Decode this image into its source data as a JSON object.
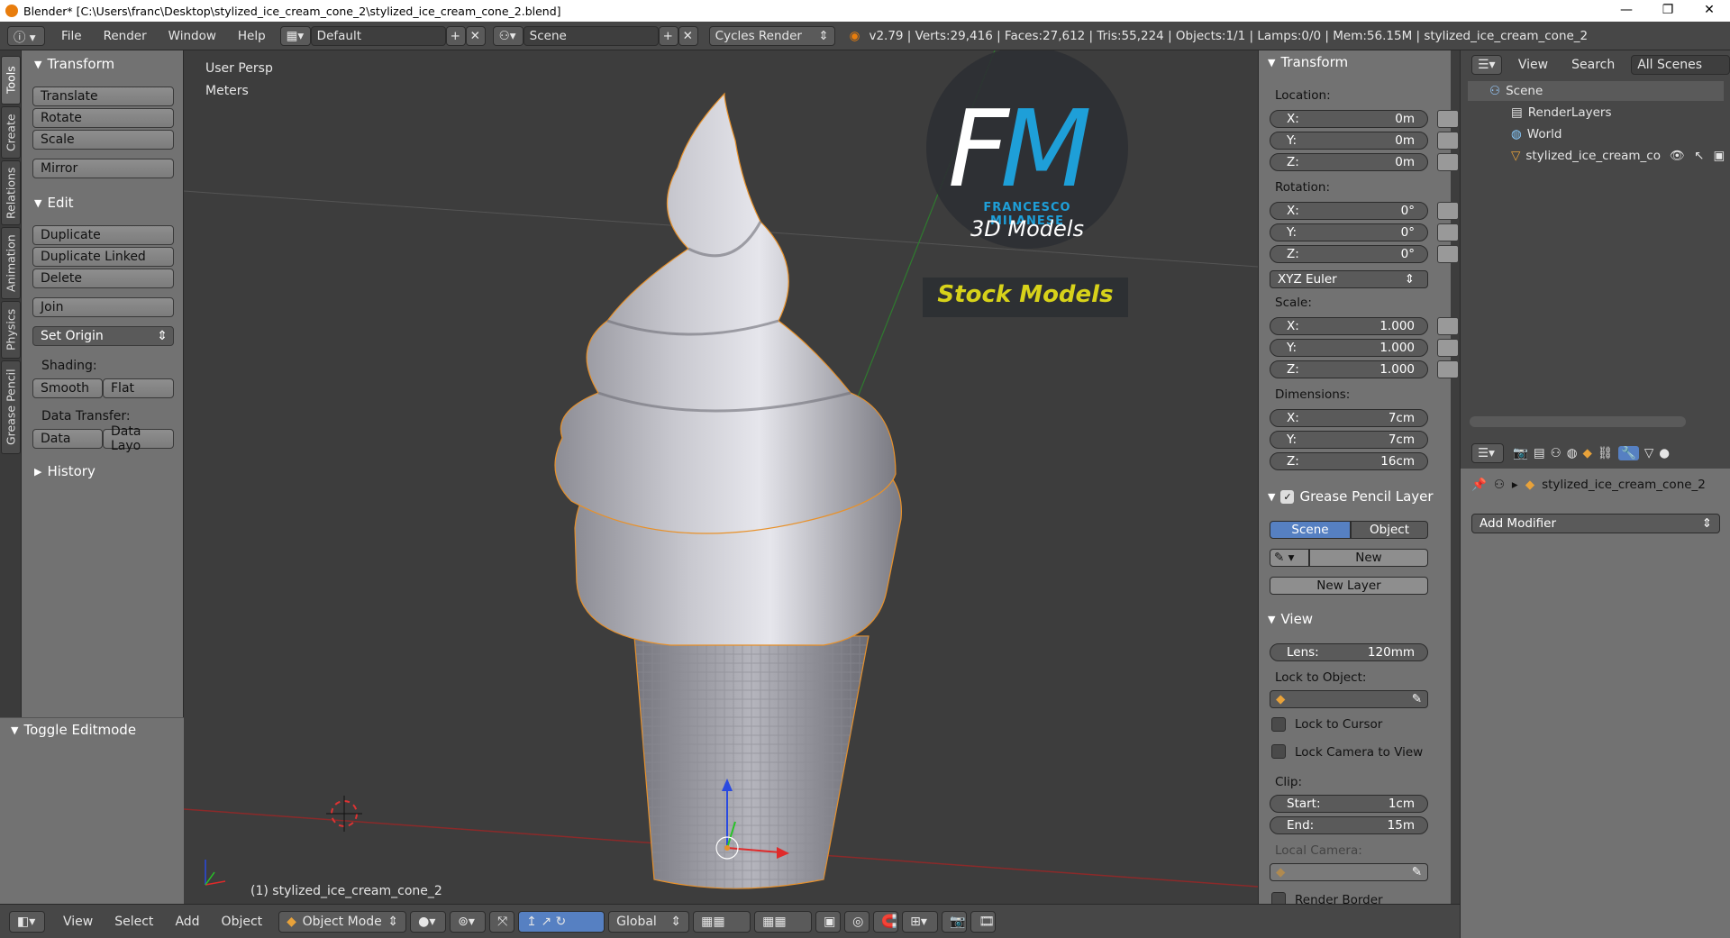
{
  "window": {
    "title": "Blender* [C:\\Users\\franc\\Desktop\\stylized_ice_cream_cone_2\\stylized_ice_cream_cone_2.blend]"
  },
  "infobar": {
    "menus": [
      "File",
      "Render",
      "Window",
      "Help"
    ],
    "layout": "Default",
    "scene": "Scene",
    "engine": "Cycles Render",
    "stats": "v2.79 | Verts:29,416 | Faces:27,612 | Tris:55,224 | Objects:1/1 | Lamps:0/0 | Mem:56.15M | stylized_ice_cream_cone_2"
  },
  "left_tabs": [
    "Tools",
    "Create",
    "Relations",
    "Animation",
    "Physics",
    "Grease Pencil"
  ],
  "toolshelf": {
    "transform_title": "Transform",
    "translate": "Translate",
    "rotate": "Rotate",
    "scale": "Scale",
    "mirror": "Mirror",
    "edit_title": "Edit",
    "duplicate": "Duplicate",
    "duplicate_linked": "Duplicate Linked",
    "delete": "Delete",
    "join": "Join",
    "set_origin": "Set Origin",
    "shading_label": "Shading:",
    "smooth": "Smooth",
    "flat": "Flat",
    "data_transfer_label": "Data Transfer:",
    "data": "Data",
    "data_layout": "Data Layo",
    "history_title": "History",
    "toggle_editmode": "Toggle Editmode"
  },
  "viewport": {
    "view_name": "User Persp",
    "units": "Meters",
    "object_label": "(1) stylized_ice_cream_cone_2",
    "logo_brand": "FRANCESCO MILANESE",
    "logo_sub": "3D Models",
    "logo_stock": "Stock Models"
  },
  "npanel": {
    "transform_title": "Transform",
    "location_label": "Location:",
    "loc": [
      {
        "axis": "X:",
        "value": "0m"
      },
      {
        "axis": "Y:",
        "value": "0m"
      },
      {
        "axis": "Z:",
        "value": "0m"
      }
    ],
    "rotation_label": "Rotation:",
    "rot": [
      {
        "axis": "X:",
        "value": "0°"
      },
      {
        "axis": "Y:",
        "value": "0°"
      },
      {
        "axis": "Z:",
        "value": "0°"
      }
    ],
    "rotation_mode": "XYZ Euler",
    "scale_label": "Scale:",
    "scl": [
      {
        "axis": "X:",
        "value": "1.000"
      },
      {
        "axis": "Y:",
        "value": "1.000"
      },
      {
        "axis": "Z:",
        "value": "1.000"
      }
    ],
    "dimensions_label": "Dimensions:",
    "dim": [
      {
        "axis": "X:",
        "value": "7cm"
      },
      {
        "axis": "Y:",
        "value": "7cm"
      },
      {
        "axis": "Z:",
        "value": "16cm"
      }
    ],
    "gp_title": "Grease Pencil Layer",
    "gp_scene": "Scene",
    "gp_object": "Object",
    "gp_new": "New",
    "gp_new_layer": "New Layer",
    "view_title": "View",
    "lens_label": "Lens:",
    "lens_value": "120mm",
    "lock_to_object": "Lock to Object:",
    "lock_to_cursor": "Lock to Cursor",
    "lock_camera": "Lock Camera to View",
    "clip_label": "Clip:",
    "clip_start_label": "Start:",
    "clip_start": "1cm",
    "clip_end_label": "End:",
    "clip_end": "15m",
    "local_camera": "Local Camera:",
    "render_border": "Render Border"
  },
  "outliner": {
    "view": "View",
    "search": "Search",
    "all_scenes": "All Scenes",
    "scene": "Scene",
    "render_layers": "RenderLayers",
    "world": "World",
    "object": "stylized_ice_cream_co"
  },
  "properties": {
    "object_name": "stylized_ice_cream_cone_2",
    "add_modifier": "Add Modifier"
  },
  "bottombar": {
    "view": "View",
    "select": "Select",
    "add": "Add",
    "object": "Object",
    "mode": "Object Mode",
    "orientation": "Global"
  },
  "colors": {
    "accent": "#5680c2",
    "logo_blue": "#1e9fd8",
    "logo_yellow": "#d7d21a"
  }
}
